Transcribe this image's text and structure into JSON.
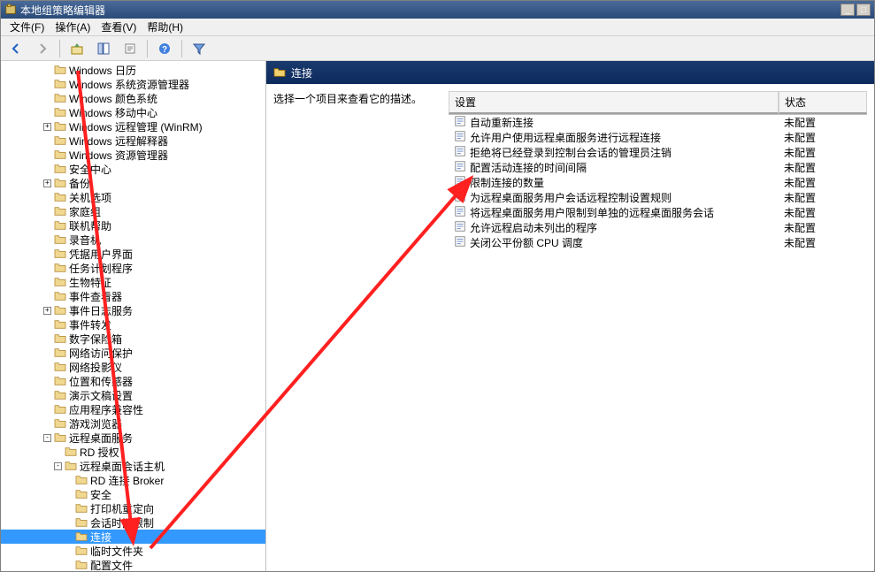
{
  "window": {
    "title": "本地组策略编辑器"
  },
  "menu": {
    "file": "文件(F)",
    "action": "操作(A)",
    "view": "查看(V)",
    "help": "帮助(H)"
  },
  "tree": [
    {
      "indent": 4,
      "exp": "",
      "label": "Windows 日历"
    },
    {
      "indent": 4,
      "exp": "",
      "label": "Windows 系统资源管理器"
    },
    {
      "indent": 4,
      "exp": "",
      "label": "Windows 颜色系统"
    },
    {
      "indent": 4,
      "exp": "",
      "label": "Windows 移动中心"
    },
    {
      "indent": 4,
      "exp": "+",
      "label": "Windows 远程管理 (WinRM)"
    },
    {
      "indent": 4,
      "exp": "",
      "label": "Windows 远程解释器"
    },
    {
      "indent": 4,
      "exp": "",
      "label": "Windows 资源管理器"
    },
    {
      "indent": 4,
      "exp": "",
      "label": "安全中心"
    },
    {
      "indent": 4,
      "exp": "+",
      "label": "备份"
    },
    {
      "indent": 4,
      "exp": "",
      "label": "关机选项"
    },
    {
      "indent": 4,
      "exp": "",
      "label": "家庭组"
    },
    {
      "indent": 4,
      "exp": "",
      "label": "联机帮助"
    },
    {
      "indent": 4,
      "exp": "",
      "label": "录音机"
    },
    {
      "indent": 4,
      "exp": "",
      "label": "凭据用户界面"
    },
    {
      "indent": 4,
      "exp": "",
      "label": "任务计划程序"
    },
    {
      "indent": 4,
      "exp": "",
      "label": "生物特征"
    },
    {
      "indent": 4,
      "exp": "",
      "label": "事件查看器"
    },
    {
      "indent": 4,
      "exp": "+",
      "label": "事件日志服务"
    },
    {
      "indent": 4,
      "exp": "",
      "label": "事件转发"
    },
    {
      "indent": 4,
      "exp": "",
      "label": "数字保险箱"
    },
    {
      "indent": 4,
      "exp": "",
      "label": "网络访问保护"
    },
    {
      "indent": 4,
      "exp": "",
      "label": "网络投影仪"
    },
    {
      "indent": 4,
      "exp": "",
      "label": "位置和传感器"
    },
    {
      "indent": 4,
      "exp": "",
      "label": "演示文稿设置"
    },
    {
      "indent": 4,
      "exp": "",
      "label": "应用程序兼容性"
    },
    {
      "indent": 4,
      "exp": "",
      "label": "游戏浏览器"
    },
    {
      "indent": 4,
      "exp": "-",
      "label": "远程桌面服务"
    },
    {
      "indent": 5,
      "exp": "",
      "label": "RD 授权"
    },
    {
      "indent": 5,
      "exp": "-",
      "label": "远程桌面会话主机"
    },
    {
      "indent": 6,
      "exp": "",
      "label": "RD 连接 Broker"
    },
    {
      "indent": 6,
      "exp": "",
      "label": "安全"
    },
    {
      "indent": 6,
      "exp": "",
      "label": "打印机重定向"
    },
    {
      "indent": 6,
      "exp": "",
      "label": "会话时间限制"
    },
    {
      "indent": 6,
      "exp": "",
      "label": "连接",
      "selected": true
    },
    {
      "indent": 6,
      "exp": "",
      "label": "临时文件夹"
    },
    {
      "indent": 6,
      "exp": "",
      "label": "配置文件"
    }
  ],
  "right": {
    "header": "连接",
    "description": "选择一个项目来查看它的描述。",
    "columns": {
      "setting": "设置",
      "state": "状态"
    },
    "rows": [
      {
        "name": "自动重新连接",
        "state": "未配置"
      },
      {
        "name": "允许用户使用远程桌面服务进行远程连接",
        "state": "未配置"
      },
      {
        "name": "拒绝将已经登录到控制台会话的管理员注销",
        "state": "未配置"
      },
      {
        "name": "配置活动连接的时间间隔",
        "state": "未配置"
      },
      {
        "name": "限制连接的数量",
        "state": "未配置"
      },
      {
        "name": "为远程桌面服务用户会话远程控制设置规则",
        "state": "未配置"
      },
      {
        "name": "将远程桌面服务用户限制到单独的远程桌面服务会话",
        "state": "未配置"
      },
      {
        "name": "允许远程启动未列出的程序",
        "state": "未配置"
      },
      {
        "name": "关闭公平份额 CPU 调度",
        "state": "未配置"
      }
    ]
  }
}
